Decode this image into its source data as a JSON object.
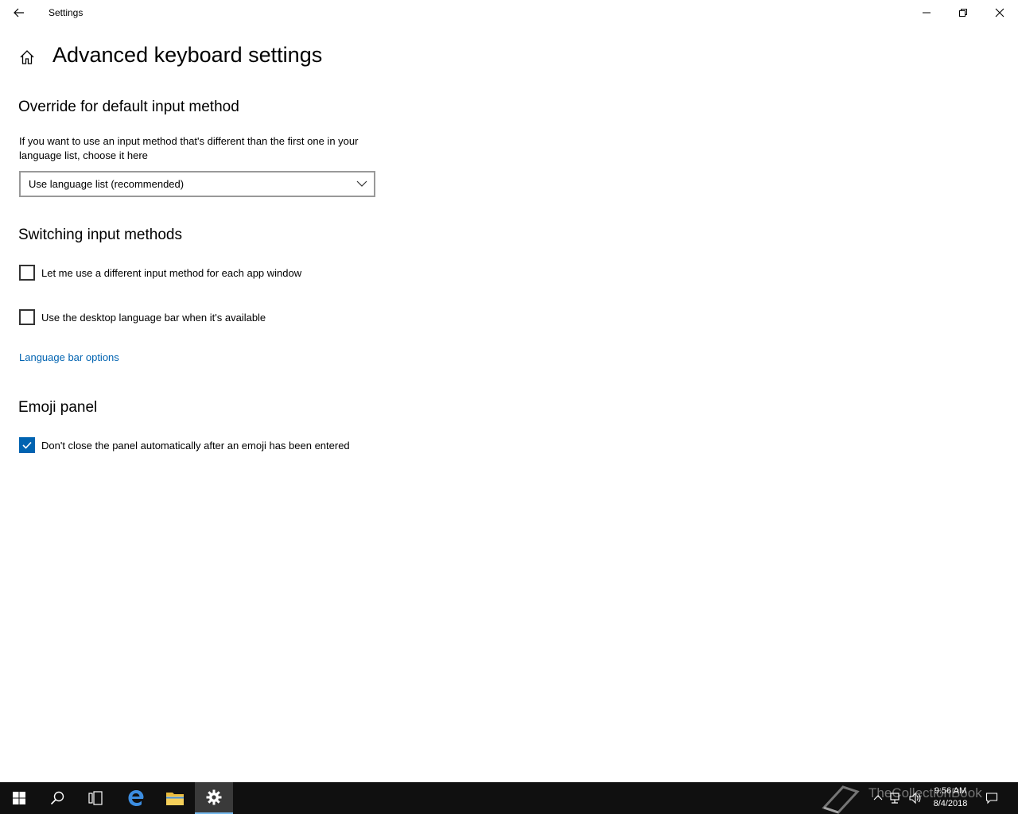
{
  "window": {
    "app_title": "Settings",
    "page_title": "Advanced keyboard settings"
  },
  "override": {
    "heading": "Override for default input method",
    "description": "If you want to use an input method that's different than the first one in your language list, choose it here",
    "dropdown_value": "Use language list (recommended)"
  },
  "switching": {
    "heading": "Switching input methods",
    "checkbox1_label": "Let me use a different input method for each app window",
    "checkbox1_checked": false,
    "checkbox2_label": "Use the desktop language bar when it's available",
    "checkbox2_checked": false,
    "link_label": "Language bar options"
  },
  "emoji": {
    "heading": "Emoji panel",
    "checkbox_label": "Don't close the panel automatically after an emoji has been entered",
    "checkbox_checked": true
  },
  "taskbar": {
    "time": "9:56 AM",
    "date": "8/4/2018",
    "watermark": "TheCollectionBook",
    "items": [
      "start-icon",
      "search-icon",
      "task-view-icon",
      "edge-icon",
      "file-explorer-icon",
      "settings-icon"
    ]
  },
  "colors": {
    "accent": "#0063b1",
    "taskbar": "#101010"
  }
}
